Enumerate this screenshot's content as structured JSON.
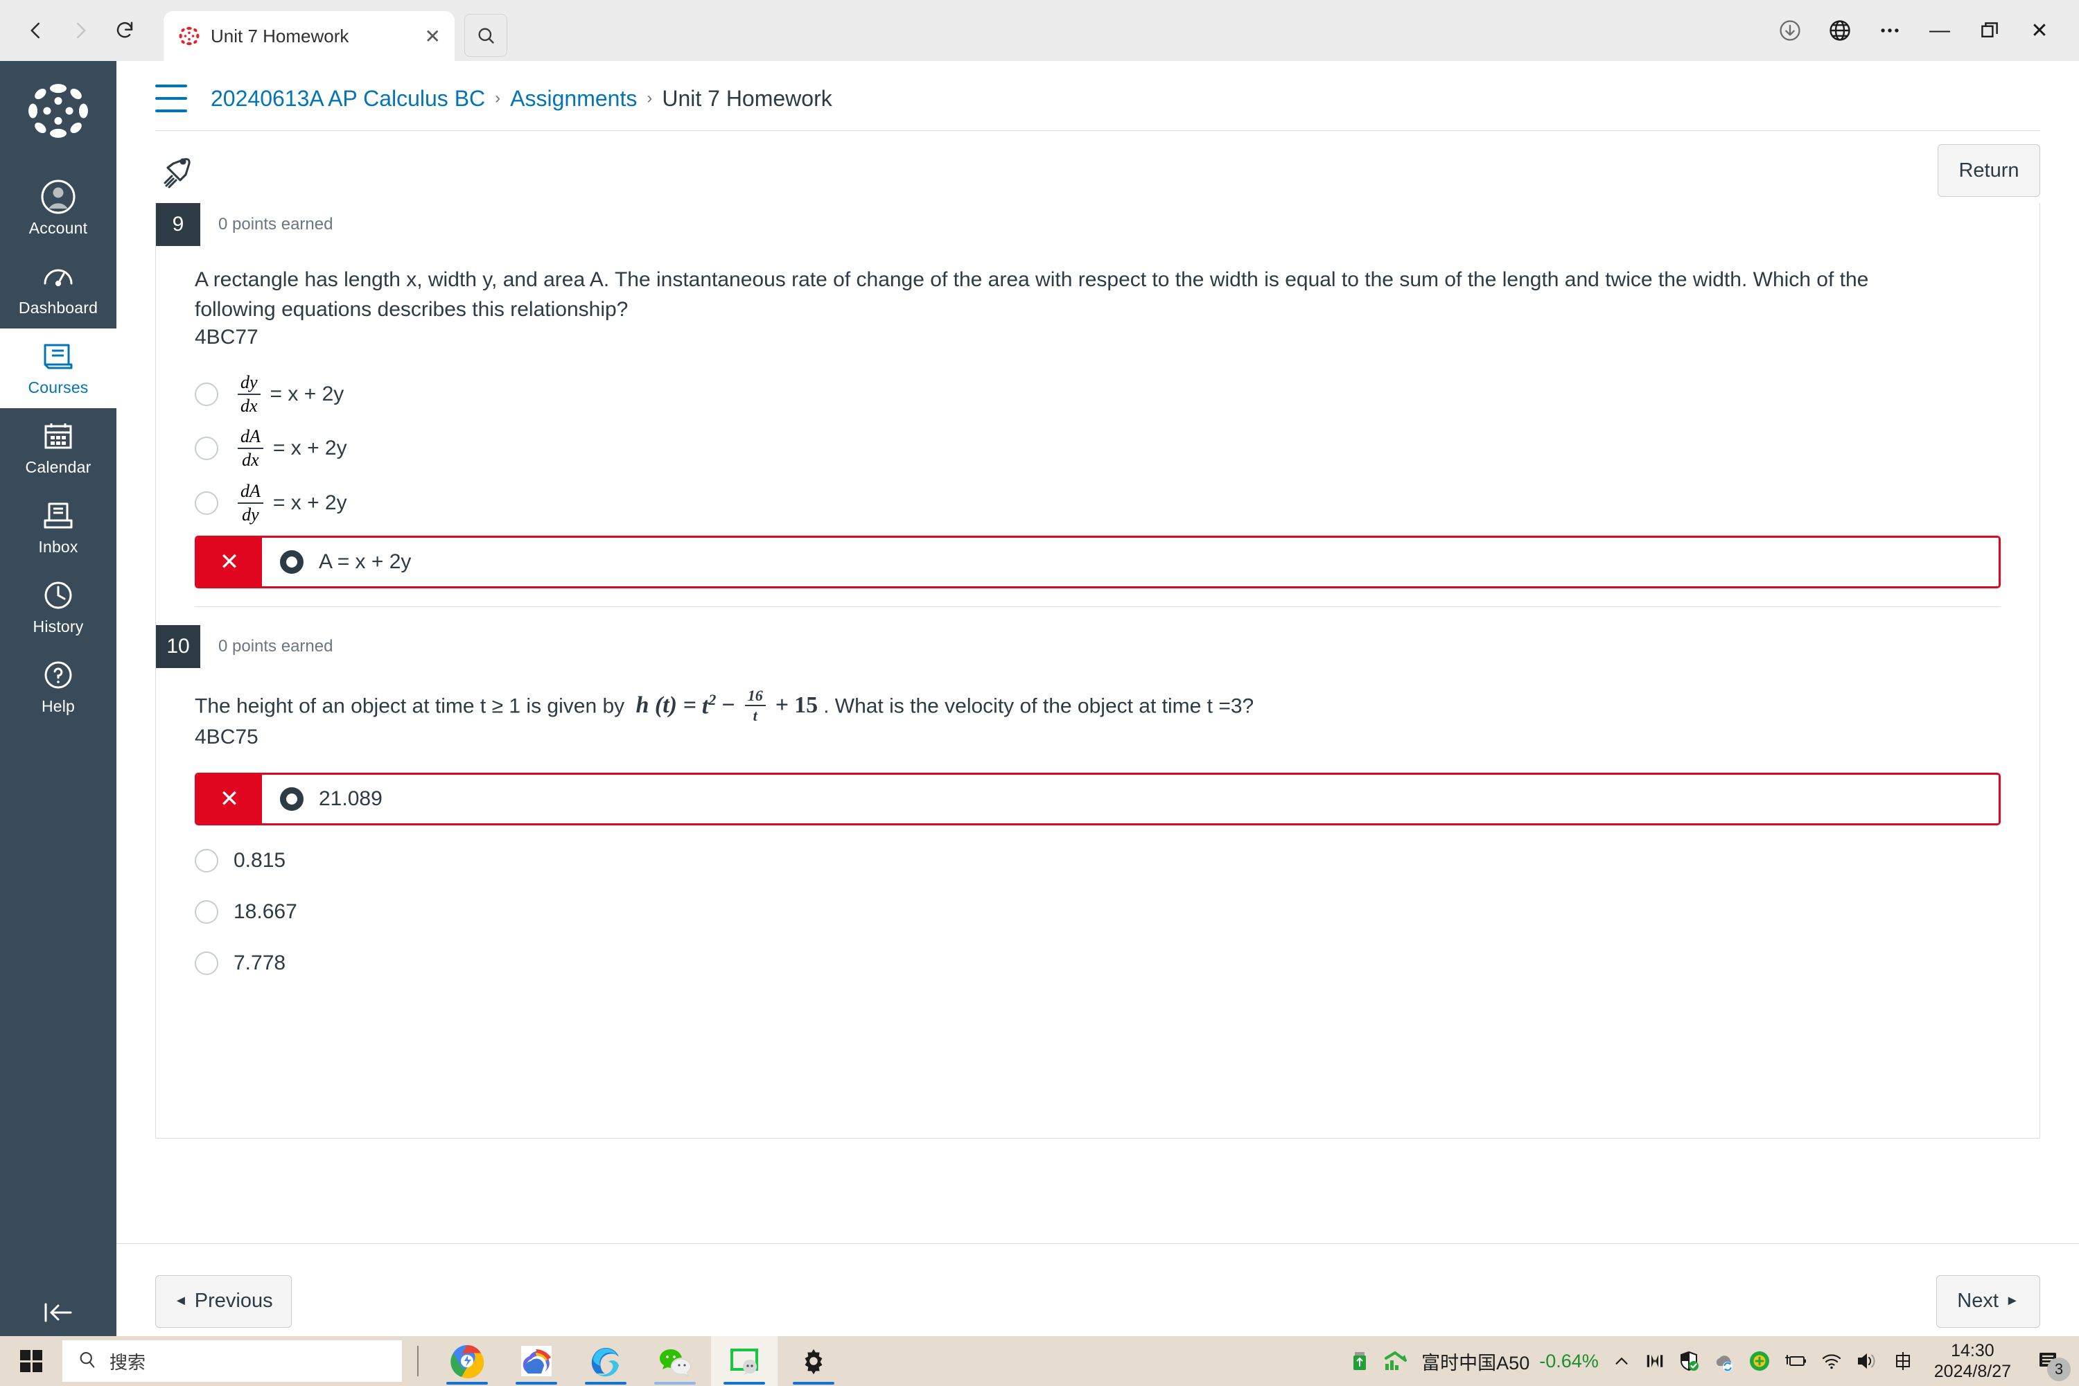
{
  "browser": {
    "back_icon": "back-arrow-icon",
    "forward_icon": "forward-arrow-icon",
    "reload_icon": "reload-icon",
    "tab_title": "Unit 7 Homework",
    "tab_close_label": "✕",
    "search_icon": "search-icon",
    "download_icon": "download-icon",
    "globe_icon": "globe-icon",
    "more_icon": "more-options-icon",
    "minimize_label": "—",
    "maximize_icon": "restore-window-icon",
    "close_label": "✕"
  },
  "sidebar": {
    "logo": "canvas-logo",
    "items": [
      {
        "label": "Account",
        "icon": "user-avatar-icon",
        "active": false
      },
      {
        "label": "Dashboard",
        "icon": "dashboard-gauge-icon",
        "active": false
      },
      {
        "label": "Courses",
        "icon": "courses-book-icon",
        "active": true
      },
      {
        "label": "Calendar",
        "icon": "calendar-icon",
        "active": false
      },
      {
        "label": "Inbox",
        "icon": "inbox-tray-icon",
        "active": false
      },
      {
        "label": "History",
        "icon": "clock-history-icon",
        "active": false
      },
      {
        "label": "Help",
        "icon": "help-question-icon",
        "active": false
      }
    ],
    "collapse_icon": "collapse-left-icon"
  },
  "header": {
    "menu_icon": "hamburger-menu-icon",
    "breadcrumb": [
      {
        "label": "20240613A AP Calculus BC",
        "link": true
      },
      {
        "label": "Assignments",
        "link": true
      },
      {
        "label": "Unit 7 Homework",
        "link": false
      }
    ],
    "separator": "›"
  },
  "toolbar": {
    "rocket_icon": "rocket-icon",
    "return_label": "Return"
  },
  "questions": [
    {
      "number": "9",
      "points_text": "0 points earned",
      "prompt": "A rectangle has length x, width y, and area A. The instantaneous rate of change of the area with respect to the width is equal to the sum of the length and twice the width. Which of the following equations describes this relationship?",
      "code": "4BC77",
      "options": [
        {
          "id": "q9-a",
          "kind": "fraction",
          "numerator": "dy",
          "denominator": "dx",
          "rhs": "= x + 2y",
          "selected": false,
          "marked_wrong": false
        },
        {
          "id": "q9-b",
          "kind": "fraction",
          "numerator": "dA",
          "denominator": "dx",
          "rhs": "= x + 2y",
          "selected": false,
          "marked_wrong": false
        },
        {
          "id": "q9-c",
          "kind": "fraction",
          "numerator": "dA",
          "denominator": "dy",
          "rhs": "= x + 2y",
          "selected": false,
          "marked_wrong": false
        },
        {
          "id": "q9-d",
          "kind": "text",
          "text": "A = x + 2y",
          "selected": true,
          "marked_wrong": true
        }
      ],
      "wrong_mark": "✕"
    },
    {
      "number": "10",
      "points_text": "0 points earned",
      "prompt_before": "The height of an object at time t ≥ 1 is given by",
      "formula": {
        "lhs": "h (t) =",
        "term1": "t",
        "term1_exp": "2",
        "minus": "−",
        "frac_num": "16",
        "frac_den": "t",
        "plus": "+",
        "term3": "15"
      },
      "prompt_after": ". What is the velocity of the object at time t =3?",
      "code": "4BC75",
      "options": [
        {
          "id": "q10-a",
          "kind": "text",
          "text": "21.089",
          "selected": true,
          "marked_wrong": true
        },
        {
          "id": "q10-b",
          "kind": "text",
          "text": "0.815",
          "selected": false,
          "marked_wrong": false
        },
        {
          "id": "q10-c",
          "kind": "text",
          "text": "18.667",
          "selected": false,
          "marked_wrong": false
        },
        {
          "id": "q10-d",
          "kind": "text",
          "text": "7.778",
          "selected": false,
          "marked_wrong": false
        }
      ],
      "wrong_mark": "✕"
    }
  ],
  "pagination": {
    "previous_label": "Previous",
    "previous_arrow": "◄",
    "next_label": "Next",
    "next_arrow": "►"
  },
  "taskbar": {
    "start_icon": "windows-start-icon",
    "search_icon": "search-icon",
    "search_placeholder": "搜索",
    "apps": [
      {
        "name": "chrome-app-icon",
        "active": false
      },
      {
        "name": "weather-app-icon",
        "active": false
      },
      {
        "name": "edge-app-icon",
        "active": false
      },
      {
        "name": "wechat-app-icon",
        "active": false
      },
      {
        "name": "screen-capture-app-icon",
        "active": true
      },
      {
        "name": "settings-gear-app-icon",
        "active": false
      }
    ],
    "tray": {
      "usb_icon": "usb-drive-icon",
      "stock_name": "富时中国A50",
      "stock_change": "-0.64%",
      "stock_change_color": "#1a8f2e",
      "chevron_icon": "show-hidden-icons-chevron",
      "monitor_icon": "monitor-icon",
      "shield_icon": "security-shield-icon",
      "onedrive_icon": "onedrive-sync-icon",
      "safe_icon": "green-safe-icon",
      "battery_icon": "battery-charging-icon",
      "wifi_icon": "wifi-icon",
      "volume_icon": "volume-icon",
      "ime_icon": "中",
      "time": "14:30",
      "date": "2024/8/27",
      "notification_icon": "notification-icon",
      "notification_count": "3"
    }
  },
  "colors": {
    "canvas_nav": "#394B58",
    "link_blue": "#0374B5",
    "text_dark": "#2D3B45",
    "wrong_red": "#E0061F",
    "taskbar": "#e6ddd0"
  }
}
